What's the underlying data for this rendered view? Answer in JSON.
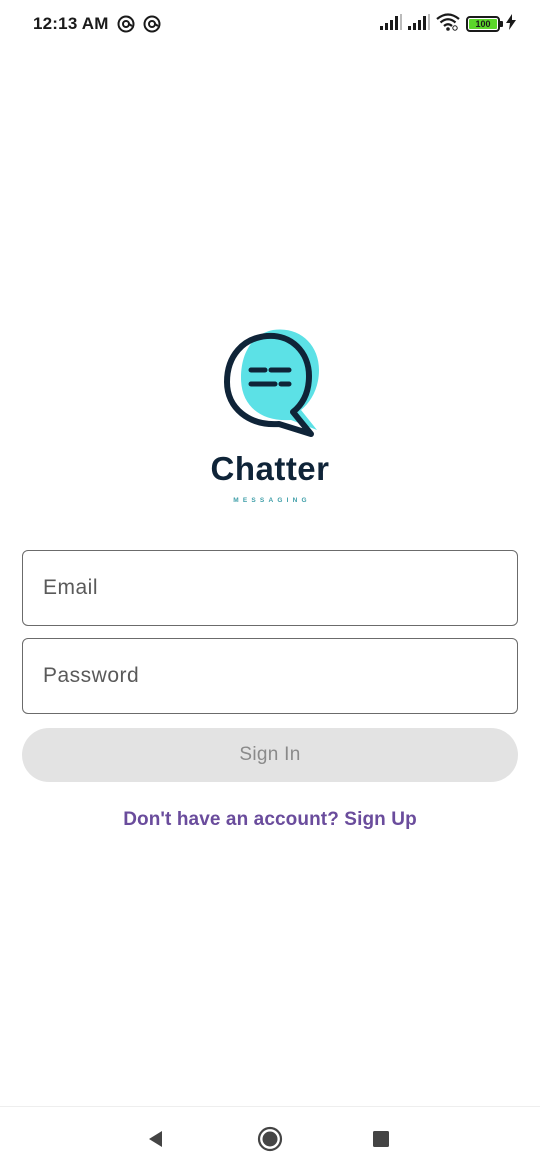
{
  "status_bar": {
    "time": "12:13 AM",
    "battery_level": "100",
    "icons": [
      "at-sign-icon",
      "at-sign-icon",
      "signal-icon",
      "signal-icon",
      "wifi-icon",
      "battery-icon",
      "charging-bolt-icon"
    ]
  },
  "brand": {
    "name": "Chatter",
    "tagline": "MESSAGING",
    "colors": {
      "accent": "#5ce1e6",
      "dark": "#0f2438",
      "tagline": "#3e9ea8"
    }
  },
  "form": {
    "email_placeholder": "Email",
    "password_placeholder": "Password",
    "signin_label": "Sign In",
    "signup_link": "Don't have an account? Sign Up"
  },
  "nav": {
    "icons": [
      "back-icon",
      "home-icon",
      "recent-apps-icon"
    ]
  }
}
